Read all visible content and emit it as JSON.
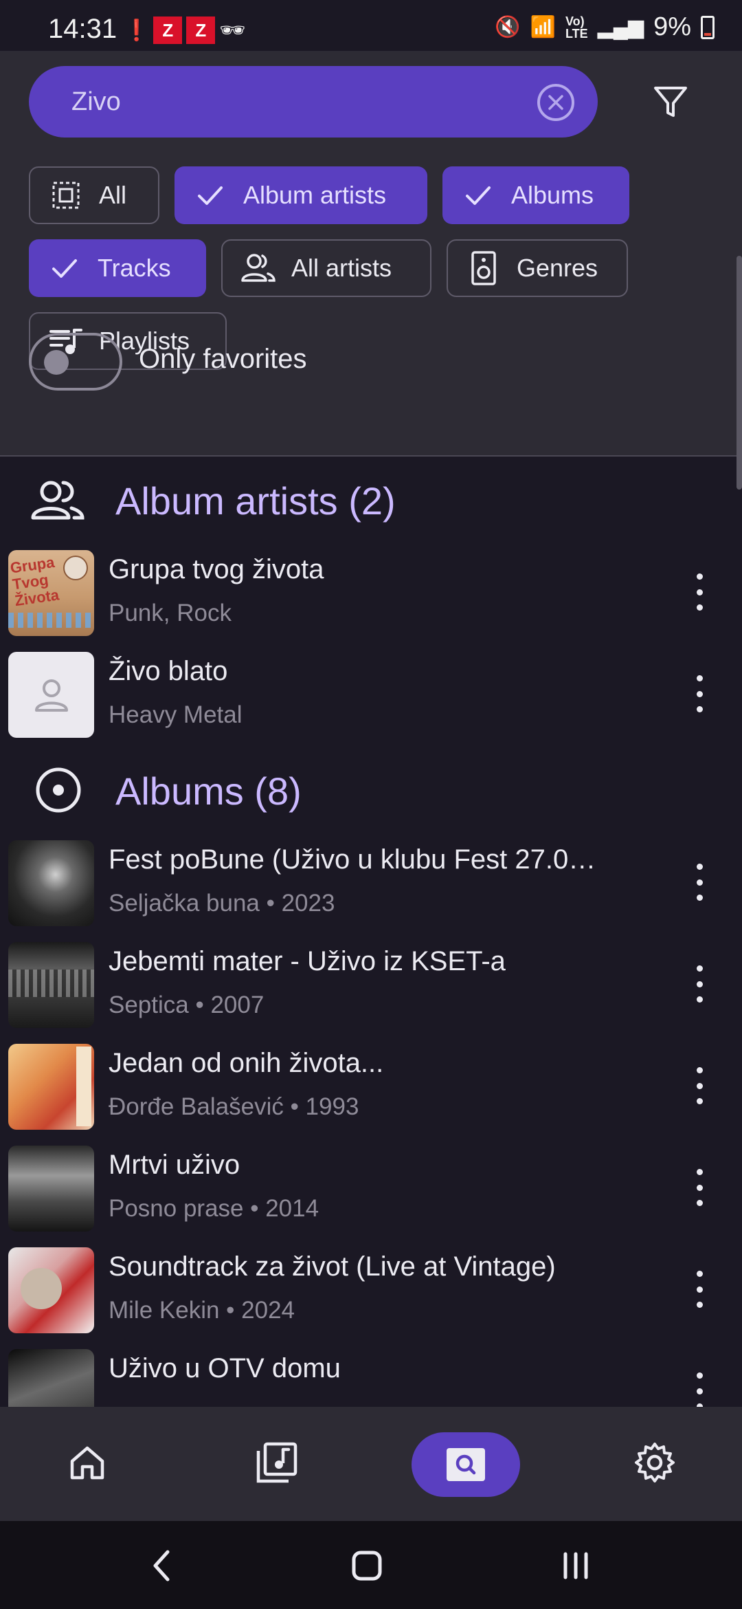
{
  "status_bar": {
    "time": "14:31",
    "battery": "9%"
  },
  "search": {
    "value": "Zivo",
    "placeholder": ""
  },
  "chips": [
    {
      "label": "All",
      "selected": false,
      "icon": "select-all-icon"
    },
    {
      "label": "Album artists",
      "selected": true,
      "icon": "check-icon"
    },
    {
      "label": "Albums",
      "selected": true,
      "icon": "check-icon"
    },
    {
      "label": "Tracks",
      "selected": true,
      "icon": "check-icon"
    },
    {
      "label": "All artists",
      "selected": false,
      "icon": "people-icon"
    },
    {
      "label": "Genres",
      "selected": false,
      "icon": "speaker-icon"
    },
    {
      "label": "Playlists",
      "selected": false,
      "icon": "playlist-icon"
    }
  ],
  "favorites_toggle": {
    "label": "Only favorites",
    "on": false
  },
  "sections": {
    "album_artists": {
      "title": "Album artists",
      "count": "(2)",
      "items": [
        {
          "title": "Grupa tvog života",
          "subtitle": "Punk, Rock"
        },
        {
          "title": "Živo blato",
          "subtitle": "Heavy Metal"
        }
      ]
    },
    "albums": {
      "title": "Albums",
      "count": "(8)",
      "items": [
        {
          "title": " Fest poBune (Uživo u klubu Fest 27.0…",
          "subtitle": "Seljačka buna • 2023"
        },
        {
          "title": "Jebemti mater - Uživo iz KSET-a",
          "subtitle": "Septica • 2007"
        },
        {
          "title": "Jedan od onih života...",
          "subtitle": "Đorđe Balašević • 1993"
        },
        {
          "title": "Mrtvi uživo",
          "subtitle": "Posno prase • 2014"
        },
        {
          "title": "Soundtrack za život (Live at Vintage)",
          "subtitle": "Mile Kekin • 2024"
        },
        {
          "title": "Uživo u OTV domu",
          "subtitle": ""
        }
      ]
    }
  },
  "colors": {
    "accent": "#5a3fc0",
    "accent_text": "#cbb9ff",
    "background": "#1b1824",
    "panel": "#2d2b34"
  },
  "bottom_nav": [
    "home-icon",
    "library-icon",
    "search-icon",
    "settings-icon"
  ]
}
